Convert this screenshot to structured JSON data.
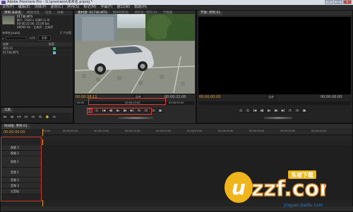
{
  "window": {
    "title": "Adobe Premiere Pro - G:\\premiere\\未命名.prproj *",
    "buttons": [
      "—",
      "▢",
      "✕"
    ]
  },
  "menu": [
    "文件(F)",
    "编辑(E)",
    "项目(P)",
    "素材(C)",
    "序列(S)",
    "标记(M)",
    "字幕(T)",
    "窗口(W)",
    "帮助(H)"
  ],
  "project": {
    "tabs": [
      "项目:未命名",
      "媒体浏览",
      "信息",
      "效果"
    ],
    "clip_name": "01736.MTS",
    "clip_info": [
      "影片, 1920 x 1080 (1.0)",
      "00:00:22:00, 25.00 fps",
      "48000 Hz - 立体声 - 立体声"
    ],
    "project_name": "未命名.prproj",
    "item_count": "2 个分项",
    "search_label": "入口:",
    "search_value": "全部",
    "columns": [
      "名称",
      "标签"
    ],
    "items": [
      "序列 01",
      "01736.MTS"
    ]
  },
  "source": {
    "tabs": [
      "素材源: 01736.MTS",
      "特效控制台",
      "调音台: 序列 01",
      "元数据"
    ],
    "timecode_in": "00:00:20:11",
    "fit": "适合",
    "timecode_out": "00:00:22:00",
    "ruler_labels": [
      "00:00",
      "00:00:15:00",
      "00:00:30:00"
    ]
  },
  "program": {
    "tabs": [
      "节目: 序列 01"
    ],
    "timecode_in": "00:00:00:00",
    "fit": "适合",
    "timecode_out": "00:00:00:00"
  },
  "tools_label": "工具",
  "timeline": {
    "tabs": [
      "时间线: 序列 01"
    ],
    "timecode": "00:00:00:00",
    "ruler": [
      "00:00",
      "00:00:05:00",
      "00:00:10:00",
      "00:00:15:00",
      "00:00:20:00",
      "00:00:25:00",
      "00:00:30:00",
      "00:00:35:00",
      "00:00:40:00",
      "00:00:45:00"
    ],
    "tracks": [
      "视频 3",
      "视频 2",
      "视频 1",
      "音频 1",
      "音频 2",
      "音频 3",
      "主音轨"
    ]
  },
  "watermark": {
    "logo": "uzzf.com",
    "logo_tag": "东坡下载",
    "site": "jingyan.baidu.com"
  }
}
